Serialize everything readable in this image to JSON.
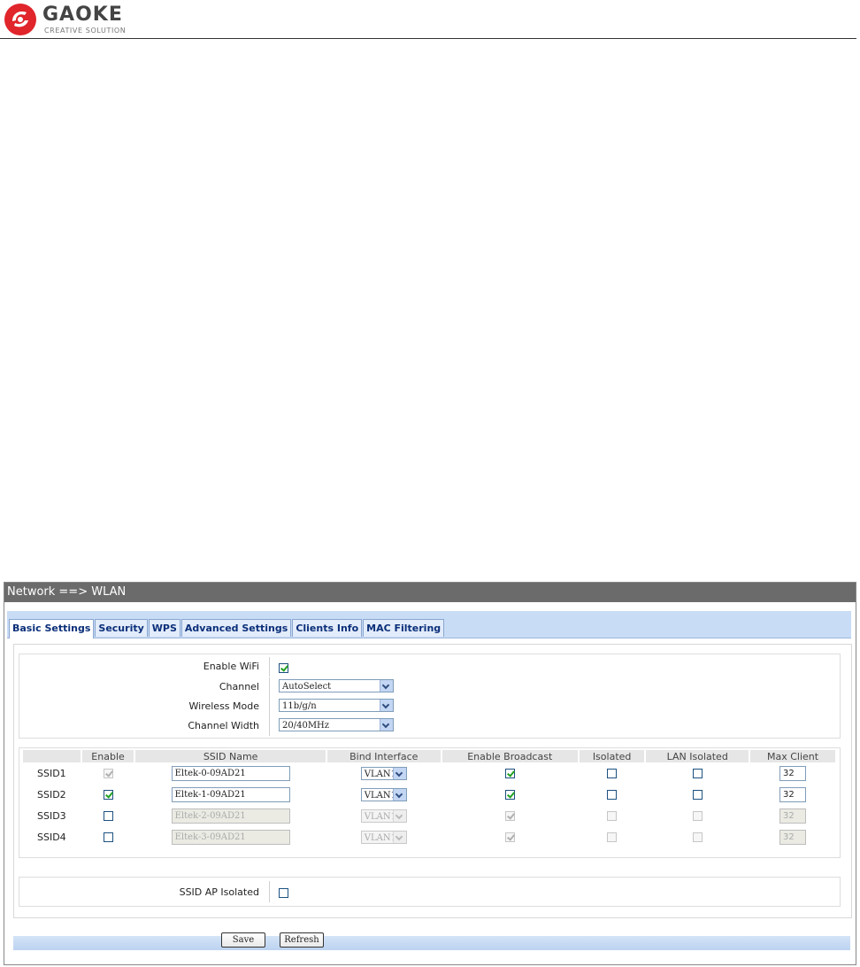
{
  "logo": {
    "word": "GAOKE",
    "tagline": "CREATIVE SOLUTION",
    "brand_color": "#e0252b"
  },
  "window": {
    "title": "Network ==> WLAN"
  },
  "tabs": [
    {
      "label": "Basic Settings",
      "active": true
    },
    {
      "label": "Security"
    },
    {
      "label": "WPS"
    },
    {
      "label": "Advanced Settings"
    },
    {
      "label": "Clients Info"
    },
    {
      "label": "MAC Filtering"
    }
  ],
  "general": {
    "enable_wifi": {
      "label": "Enable WiFi",
      "checked": true
    },
    "channel": {
      "label": "Channel",
      "value": "AutoSelect"
    },
    "wireless_mode": {
      "label": "Wireless Mode",
      "value": "11b/g/n"
    },
    "channel_width": {
      "label": "Channel Width",
      "value": "20/40MHz"
    }
  },
  "ssid_table": {
    "headers": [
      "",
      "Enable",
      "SSID Name",
      "Bind Interface",
      "Enable Broadcast",
      "Isolated",
      "LAN Isolated",
      "Max Client"
    ],
    "rows": [
      {
        "label": "SSID1",
        "enable": true,
        "name": "Eltek-0-09AD21",
        "bind": "VLAN1",
        "broadcast": true,
        "isolated": false,
        "lan_isolated": false,
        "max_client": "32"
      },
      {
        "label": "SSID2",
        "enable": true,
        "name": "Eltek-1-09AD21",
        "bind": "VLAN1",
        "broadcast": true,
        "isolated": false,
        "lan_isolated": false,
        "max_client": "32"
      },
      {
        "label": "SSID3",
        "enable": false,
        "name": "Eltek-2-09AD21",
        "bind": "VLAN1",
        "broadcast": true,
        "isolated": false,
        "lan_isolated": false,
        "max_client": "32"
      },
      {
        "label": "SSID4",
        "enable": false,
        "name": "Eltek-3-09AD21",
        "bind": "VLAN1",
        "broadcast": true,
        "isolated": false,
        "lan_isolated": false,
        "max_client": "32"
      }
    ]
  },
  "ap_isolated": {
    "label": "SSID AP Isolated",
    "checked": false
  },
  "buttons": {
    "save": "Save",
    "refresh": "Refresh"
  },
  "colors": {
    "title_bar": "#6b6b6b",
    "tab_bar": "#c8dcf5",
    "tab_text": "#0b2f7a",
    "check_mark": "#21a121"
  }
}
